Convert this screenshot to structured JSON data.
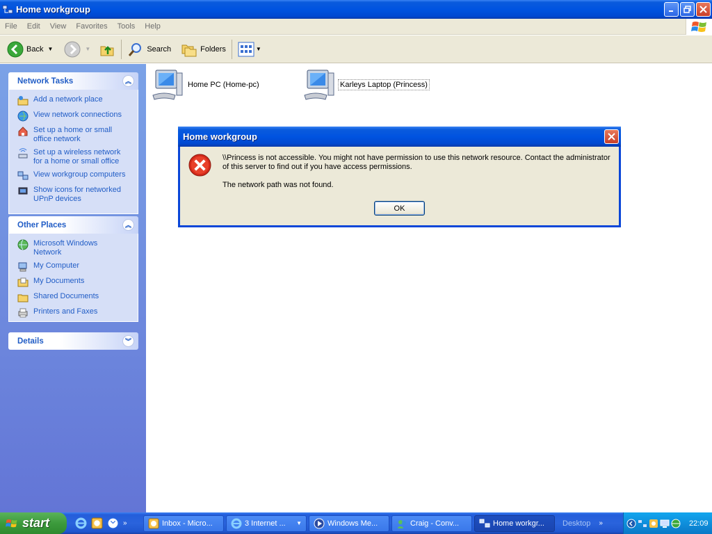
{
  "window": {
    "title": "Home workgroup"
  },
  "menu": [
    "File",
    "Edit",
    "View",
    "Favorites",
    "Tools",
    "Help"
  ],
  "toolbar": {
    "back": "Back",
    "search": "Search",
    "folders": "Folders"
  },
  "network_tasks": {
    "title": "Network Tasks",
    "items": [
      "Add a network place",
      "View network connections",
      "Set up a home or small office network",
      "Set up a wireless network for a home or small office",
      "View workgroup computers",
      "Show icons for networked UPnP devices"
    ]
  },
  "other_places": {
    "title": "Other Places",
    "items": [
      "Microsoft Windows Network",
      "My Computer",
      "My Documents",
      "Shared Documents",
      "Printers and Faxes"
    ]
  },
  "details": {
    "title": "Details"
  },
  "computers": [
    {
      "label": "Home PC (Home-pc)"
    },
    {
      "label": "Karleys Laptop (Princess)"
    }
  ],
  "dialog": {
    "title": "Home workgroup",
    "message": "\\\\Princess is not accessible. You might not have permission to use this network resource. Contact the administrator of this server to find out if you have access permissions.",
    "detail": "The network path was not found.",
    "ok": "OK"
  },
  "taskbar": {
    "start": "start",
    "buttons": [
      {
        "label": "Inbox - Micro..."
      },
      {
        "label": "3 Internet ..."
      },
      {
        "label": "Windows Me..."
      },
      {
        "label": "Craig - Conv..."
      },
      {
        "label": "Home workgr..."
      }
    ],
    "desktop": "Desktop",
    "clock": "22:09"
  }
}
